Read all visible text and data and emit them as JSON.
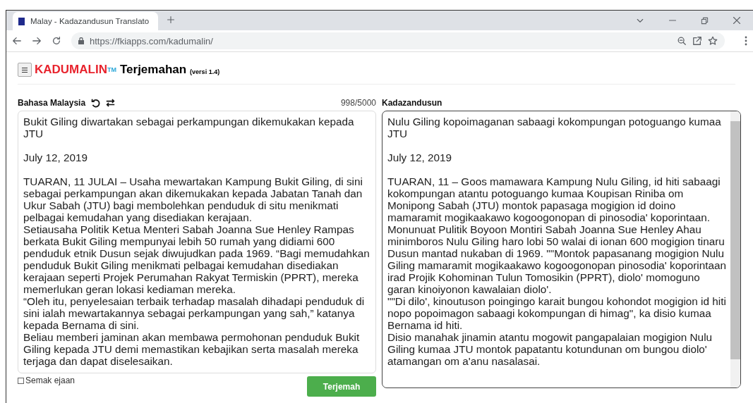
{
  "browser": {
    "tab_title": "Malay - Kadazandusun Translato",
    "url": "https://fkiapps.com/kadumalin/"
  },
  "header": {
    "brand": "KADUMALIN",
    "trademark": "TM",
    "title": "Terjemahan",
    "version": "(versi 1.4)"
  },
  "source": {
    "language": "Bahasa Malaysia",
    "counter": "998/5000",
    "text": "Bukit Giling diwartakan sebagai perkampungan dikemukakan kepada JTU\n\nJuly 12, 2019\n\nTUARAN, 11 JULAI – Usaha mewartakan Kampung Bukit Giling, di sini sebagai perkampungan akan dikemukakan kepada Jabatan Tanah dan Ukur Sabah (JTU) bagi membolehkan penduduk di situ menikmati pelbagai kemudahan yang disediakan kerajaan.\nSetiausaha Politik Ketua Menteri Sabah Joanna Sue Henley Rampas berkata Bukit Giling mempunyai lebih 50 rumah yang didiami 600 penduduk etnik Dusun sejak diwujudkan pada 1969. “Bagi memudahkan penduduk Bukit Giling menikmati pelbagai kemudahan disediakan kerajaan seperti Projek Perumahan Rakyat Termiskin (PPRT), mereka memerlukan geran lokasi kediaman mereka.\n“Oleh itu, penyelesaian terbaik terhadap masalah dihadapi penduduk di sini ialah mewartakannya sebagai perkampungan yang sah,” katanya kepada Bernama di sini.\nBeliau memberi jaminan akan membawa permohonan penduduk Bukit Giling kepada JTU demi memastikan kebajikan serta masalah mereka terjaga dan dapat diselesaikan."
  },
  "target": {
    "language": "Kadazandusun",
    "text": "Nulu Giling kopoimaganan sabaagi kokompungan potoguango kumaa JTU\n\nJuly 12, 2019\n\nTUARAN, 11 – Goos mamawara Kampung Nulu Giling, id hiti sabaagi kokompungan atantu potoguango kumaa Koupisan Riniba om Monipong Sabah (JTU) montok papasaga mogigion id doino mamaramit mogikaakawo kogoogonopan di pinosodia' koporintaan.\nMonunuat Pulitik Boyoon Montiri Sabah Joanna Sue Henley Ahau minimboros Nulu Giling haro lobi 50 walai di ionan 600 mogigion tinaru Dusun mantad nukaban di 1969. \"\"Montok papasanang mogigion Nulu Giling mamaramit mogikaakawo kogoogonopan pinosodia' koporintaan irad Projik Kohominan Tulun Tomosikin (PPRT), diolo' momoguno garan kinoiyonon kawalaian diolo'.\n\"\"Di dilo', kinoutuson poingingo karait bungou kohondot mogigion id hiti nopo popoimagon sabaagi kokompungan di himag\", ka disio kumaa Bernama id hiti.\nDisio manahak jinamin atantu mogowit pangapalaian mogigion Nulu Giling kumaa JTU montok papatantu kotundunan om bungou diolo' atamangan om a'anu nasalasai."
  },
  "spellcheck": {
    "label": "Semak ejaan",
    "checked": false
  },
  "translate_button": "Terjemah"
}
